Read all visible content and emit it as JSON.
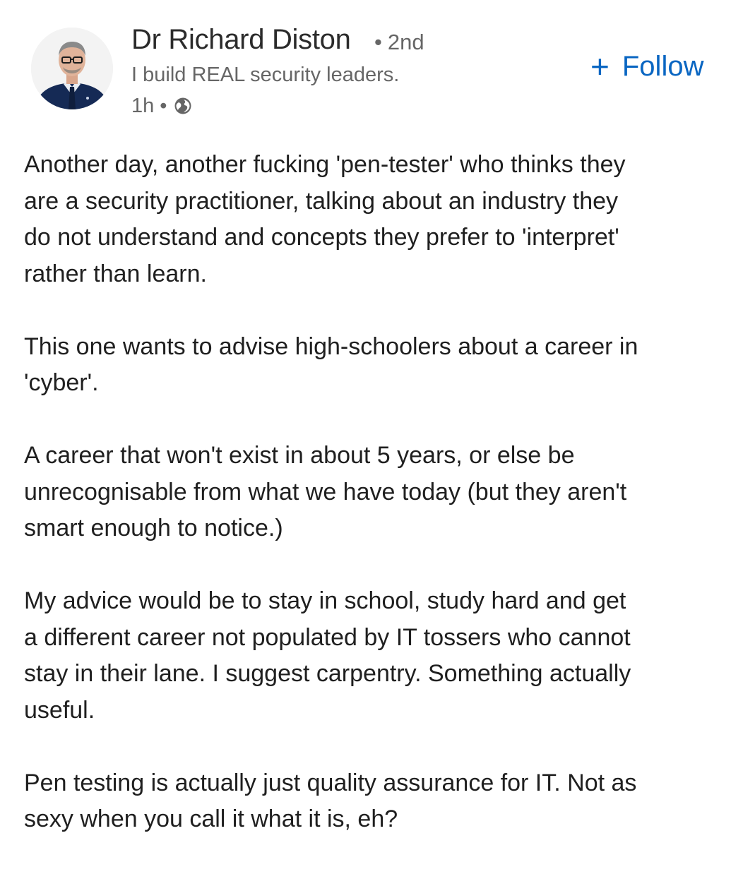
{
  "post": {
    "author": {
      "name": "Dr Richard Diston",
      "connection_degree": "2nd",
      "headline": "I build REAL security leaders.",
      "time_posted": "1h",
      "visibility_icon": "globe-icon"
    },
    "follow_button": {
      "icon": "plus-icon",
      "plus": "+",
      "label": "Follow"
    },
    "body": {
      "paragraphs": [
        {
          "lines": [
            "Another day, another fucking 'pen-tester' who thinks they",
            "are a security practitioner, talking about an industry they",
            "do not understand and concepts they prefer to 'interpret'",
            "rather than learn."
          ]
        },
        {
          "lines": [
            "This one wants to advise high-schoolers about a career in",
            "'cyber'."
          ]
        },
        {
          "lines": [
            "A career that won't exist in about 5 years, or else be",
            "unrecognisable from what we have today (but they aren't",
            "smart enough to notice.)"
          ]
        },
        {
          "lines": [
            "My advice would be to stay in school, study hard and get",
            "a different career not populated by IT tossers who cannot",
            "stay in their lane. I suggest carpentry. Something actually",
            "useful."
          ]
        },
        {
          "lines": [
            "Pen testing is actually just quality assurance for IT. Not as",
            "sexy when you call it what it is, eh?"
          ]
        }
      ]
    },
    "colors": {
      "accent": "#0a66c2",
      "secondary_text": "#666666",
      "primary_text": "#1f1f1f",
      "background": "#ffffff"
    }
  }
}
